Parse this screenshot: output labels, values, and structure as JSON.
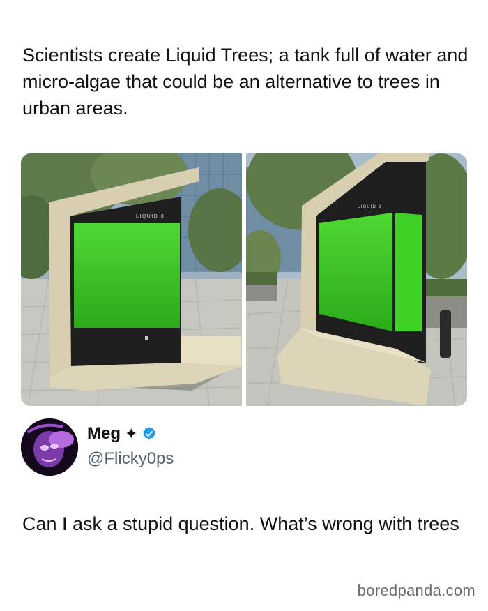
{
  "post": {
    "headline": "Scientists create Liquid Trees; a tank full of water and micro-algae that could be an alternative to trees in urban areas.",
    "photo_label_left": "LIQUID 3",
    "photo_label_right": "LIQUID 3"
  },
  "reply": {
    "display_name": "Meg",
    "sparkle": "✦",
    "handle": "@Flicky0ps",
    "text": "Can I ask a stupid question. What’s wrong with trees",
    "verified_color": "#1d9bf0"
  },
  "watermark": "boredpanda.com",
  "colors": {
    "algae_green": "#35c41e",
    "panel_black": "#1e1e1e",
    "structure_beige": "#d8cfb0"
  }
}
